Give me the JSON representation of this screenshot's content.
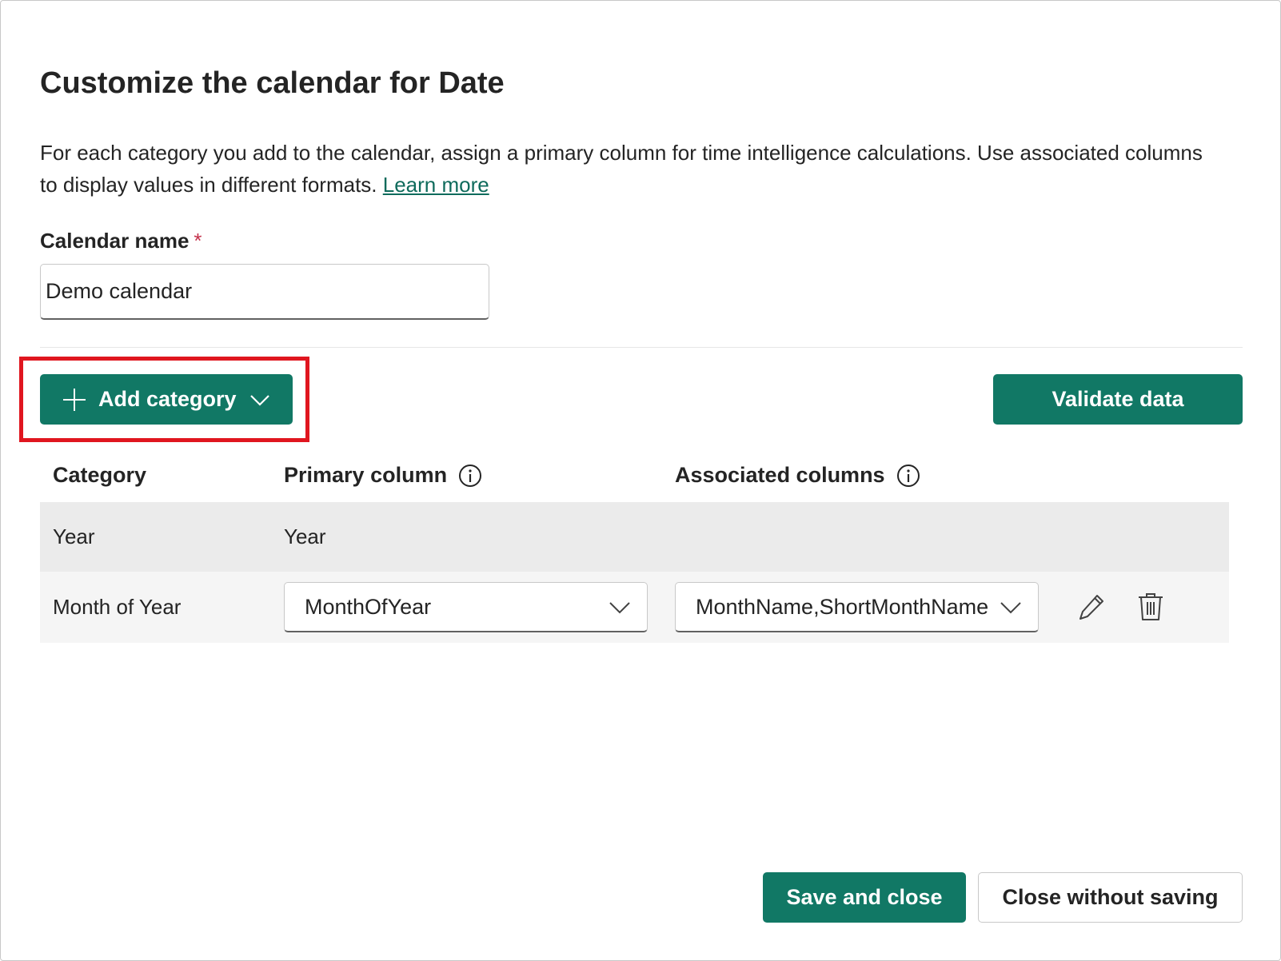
{
  "dialog": {
    "title": "Customize the calendar for Date",
    "description": "For each category you add to the calendar, assign a primary column for time intelligence calculations. Use associated columns to display values in different formats.",
    "learn_more": "Learn more"
  },
  "calendar_name": {
    "label": "Calendar name",
    "required_mark": "*",
    "value": "Demo calendar"
  },
  "toolbar": {
    "add_category_label": "Add category",
    "validate_label": "Validate data"
  },
  "table": {
    "headers": {
      "category": "Category",
      "primary": "Primary column",
      "associated": "Associated columns"
    },
    "rows": [
      {
        "category": "Year",
        "primary": "Year",
        "associated": ""
      },
      {
        "category": "Month of Year",
        "primary": "MonthOfYear",
        "associated": "MonthName,ShortMonthName"
      }
    ]
  },
  "footer": {
    "save_label": "Save and close",
    "close_label": "Close without saving"
  },
  "colors": {
    "accent": "#117865",
    "link": "#0f6b5c",
    "highlight": "#e0161f",
    "required": "#c4314b"
  },
  "icons": {
    "add": "plus-icon",
    "dropdown": "chevron-down-icon",
    "info": "info-icon",
    "edit": "pencil-icon",
    "delete": "trash-icon"
  }
}
